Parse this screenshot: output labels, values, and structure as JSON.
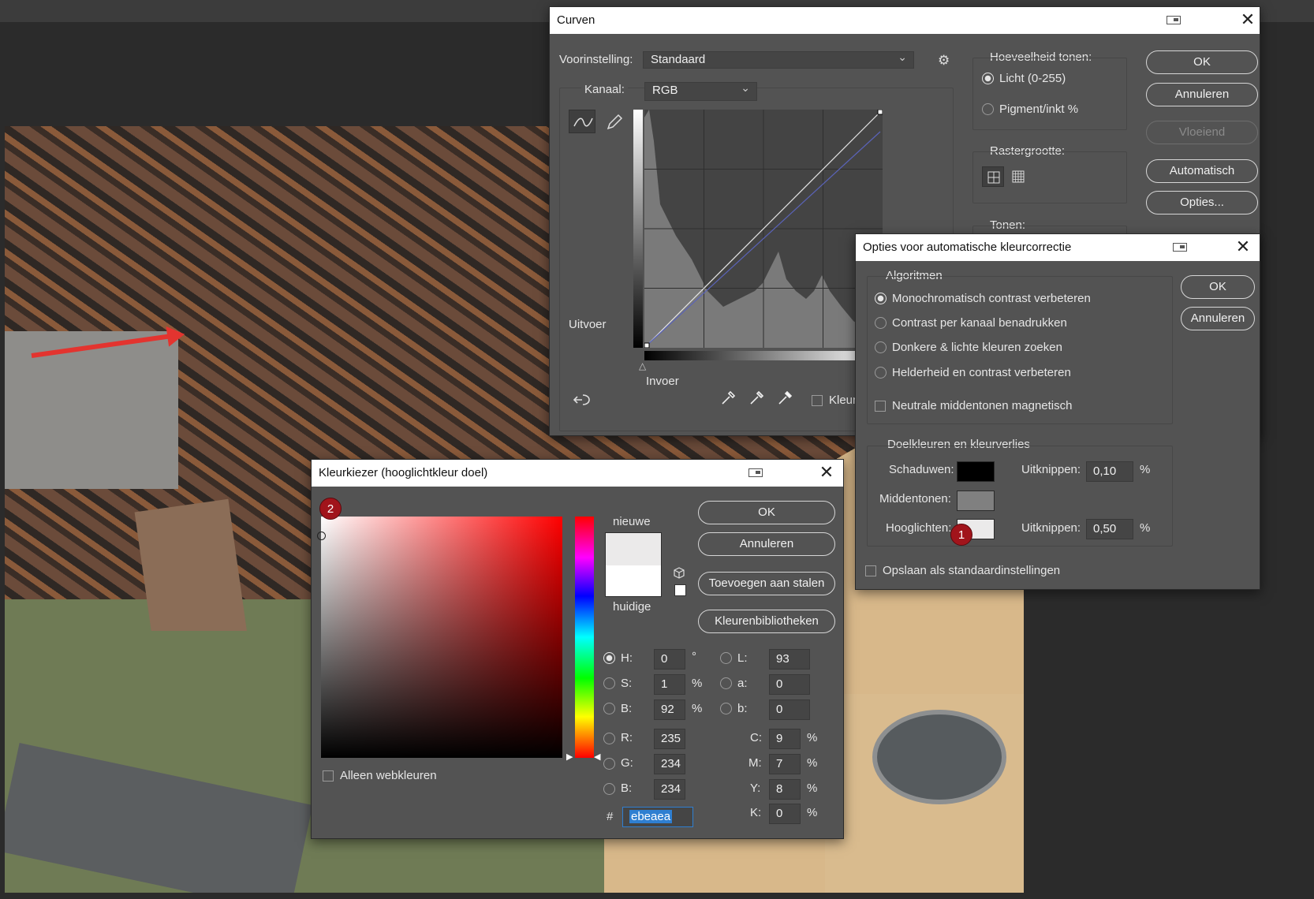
{
  "curves": {
    "title": "Curven",
    "preset_label": "Voorinstelling:",
    "preset_value": "Standaard",
    "channel_label": "Kanaal:",
    "channel_value": "RGB",
    "output_label": "Uitvoer",
    "input_label": "Invoer",
    "show_clipping_label": "Kleur",
    "tones_amount_title": "Hoeveelheid tonen:",
    "tones_light": "Licht (0-255)",
    "tones_pigment": "Pigment/inkt %",
    "grid_size_title": "Rastergrootte:",
    "tones_title": "Tonen:",
    "buttons": {
      "ok": "OK",
      "cancel": "Annuleren",
      "smooth": "Vloeiend",
      "auto": "Automatisch",
      "options": "Opties..."
    }
  },
  "auto_options": {
    "title": "Opties voor automatische kleurcorrectie",
    "algorithms_title": "Algoritmen",
    "algorithms": [
      "Monochromatisch contrast verbeteren",
      "Contrast per kanaal benadrukken",
      "Donkere & lichte kleuren zoeken",
      "Helderheid en contrast verbeteren"
    ],
    "snap_neutral": "Neutrale middentonen magnetisch",
    "targets_title": "Doelkleuren en kleurverlies",
    "shadows_label": "Schaduwen:",
    "midtones_label": "Middentonen:",
    "highlights_label": "Hooglichten:",
    "clip_label": "Uitknippen:",
    "clip_shadows": "0,10",
    "clip_highlights": "0,50",
    "percent": "%",
    "save_default": "Opslaan als standaardinstellingen",
    "badge": "1",
    "buttons": {
      "ok": "OK",
      "cancel": "Annuleren"
    },
    "colors": {
      "shadows": "#000000",
      "midtones": "#808080",
      "highlights": "#ebeaea"
    }
  },
  "picker": {
    "title": "Kleurkiezer (hooglichtkleur doel)",
    "badge": "2",
    "new_label": "nieuwe",
    "current_label": "huidige",
    "web_only": "Alleen webkleuren",
    "buttons": {
      "ok": "OK",
      "cancel": "Annuleren",
      "add_swatch": "Toevoegen aan stalen",
      "libraries": "Kleurenbibliotheken"
    },
    "H": {
      "label": "H:",
      "value": "0",
      "unit": "°"
    },
    "S": {
      "label": "S:",
      "value": "1",
      "unit": "%"
    },
    "Bv": {
      "label": "B:",
      "value": "92",
      "unit": "%"
    },
    "R": {
      "label": "R:",
      "value": "235"
    },
    "G": {
      "label": "G:",
      "value": "234"
    },
    "Bb": {
      "label": "B:",
      "value": "234"
    },
    "L": {
      "label": "L:",
      "value": "93"
    },
    "a": {
      "label": "a:",
      "value": "0"
    },
    "b": {
      "label": "b:",
      "value": "0"
    },
    "C": {
      "label": "C:",
      "value": "9",
      "unit": "%"
    },
    "M": {
      "label": "M:",
      "value": "7",
      "unit": "%"
    },
    "Y": {
      "label": "Y:",
      "value": "8",
      "unit": "%"
    },
    "K": {
      "label": "K:",
      "value": "0",
      "unit": "%"
    },
    "hash": "#",
    "hex": "ebeaea",
    "colors": {
      "new": "#ebeaea",
      "current": "#ffffff"
    }
  }
}
